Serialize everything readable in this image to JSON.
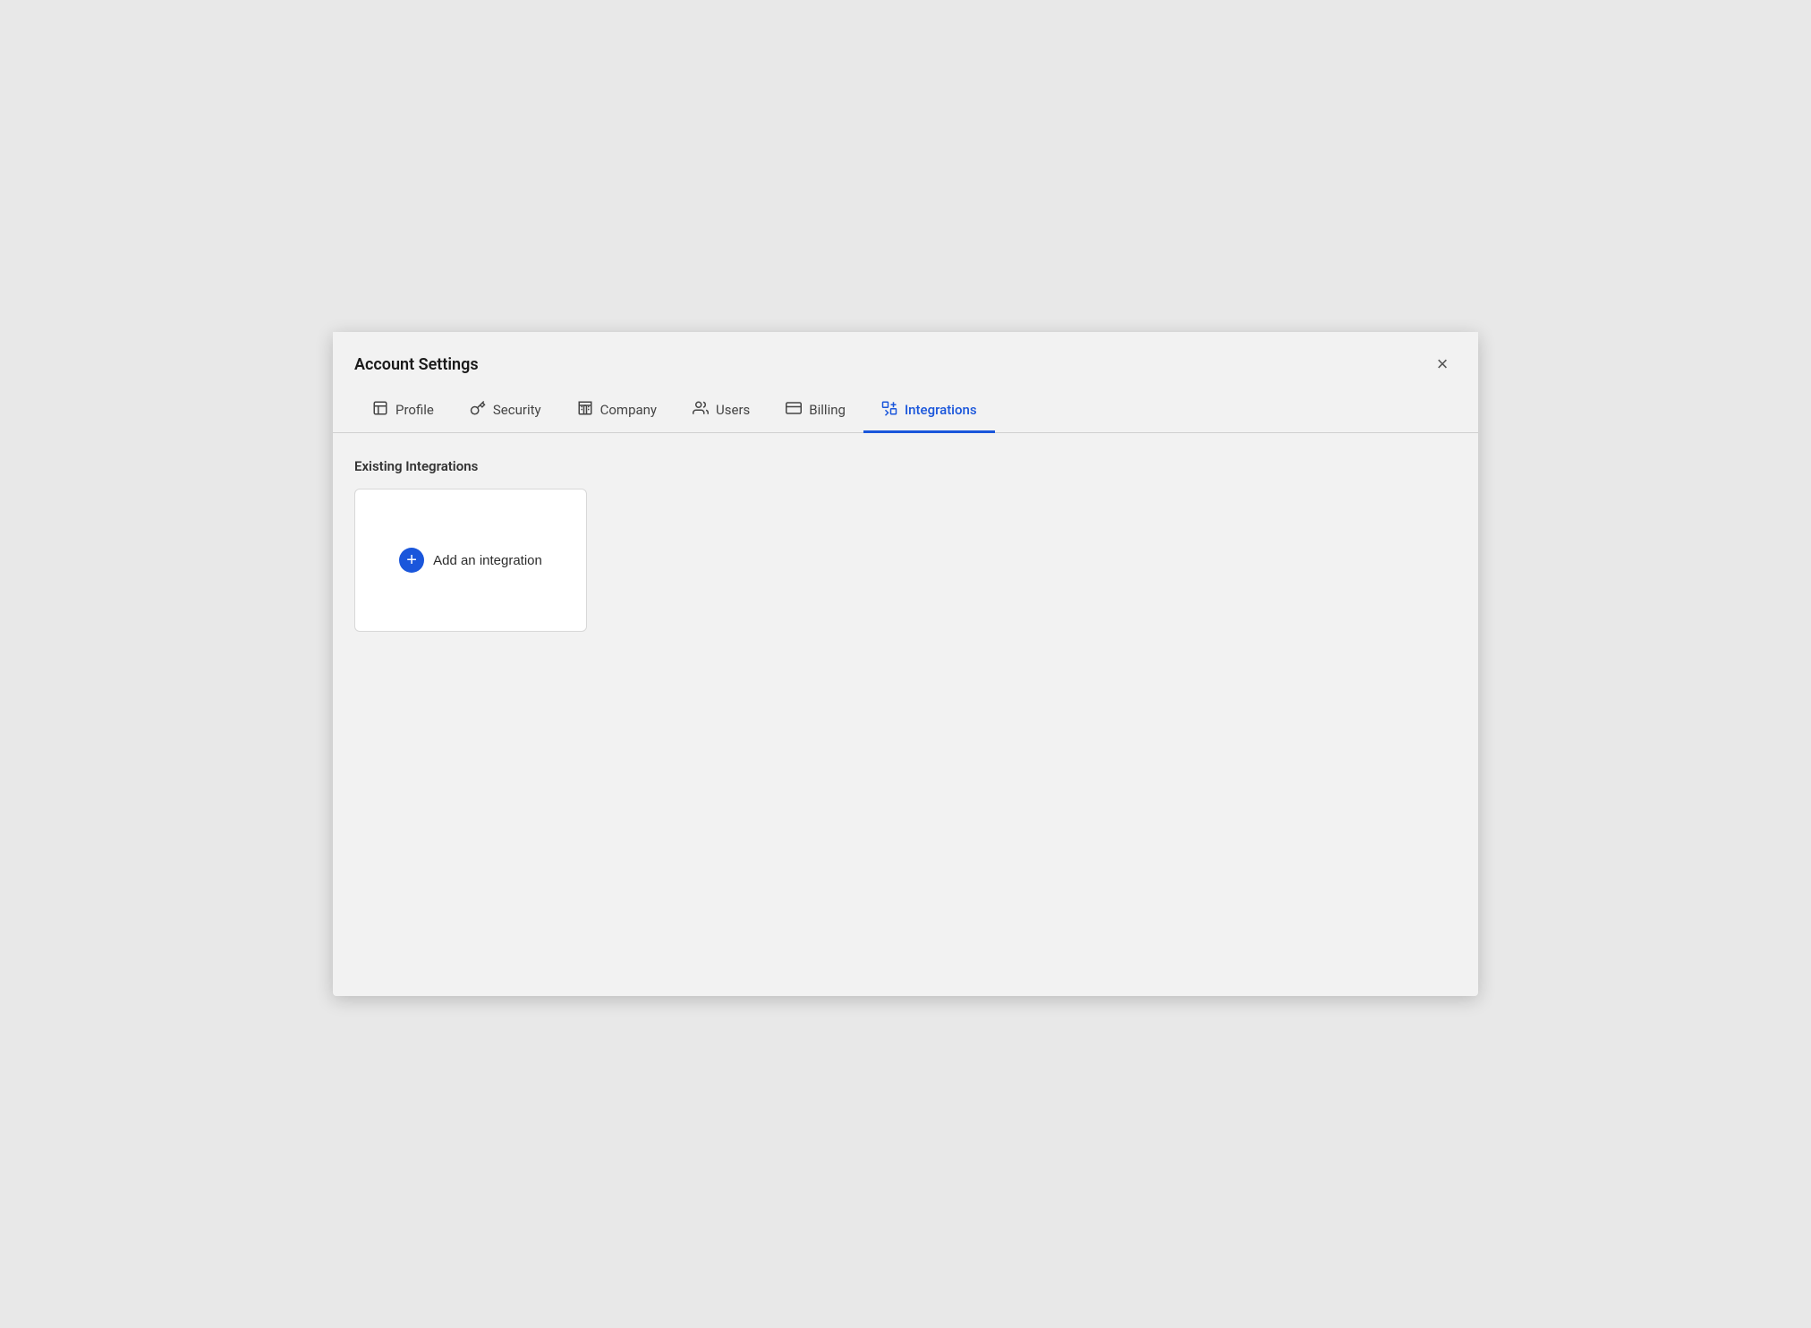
{
  "modal": {
    "title": "Account Settings",
    "close_label": "×"
  },
  "tabs": [
    {
      "id": "profile",
      "label": "Profile",
      "icon": "🪪",
      "active": false
    },
    {
      "id": "security",
      "label": "Security",
      "icon": "🔑",
      "active": false
    },
    {
      "id": "company",
      "label": "Company",
      "icon": "🏢",
      "active": false
    },
    {
      "id": "users",
      "label": "Users",
      "icon": "👥",
      "active": false
    },
    {
      "id": "billing",
      "label": "Billing",
      "icon": "💳",
      "active": false
    },
    {
      "id": "integrations",
      "label": "Integrations",
      "icon": "🔗",
      "active": true
    }
  ],
  "main": {
    "section_title": "Existing Integrations",
    "add_integration_label": "Add an integration"
  },
  "colors": {
    "active_tab": "#1a56db",
    "add_icon_bg": "#1a56db"
  }
}
